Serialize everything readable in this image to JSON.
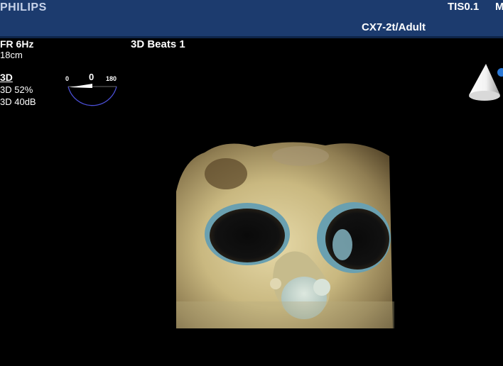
{
  "header": {
    "brand": "PHILIPS",
    "tis": "TIS0.1",
    "tis_extra": "M",
    "probe_preset": "CX7-2t/Adult"
  },
  "left_panel": {
    "frame_rate": "FR 6Hz",
    "depth": "18cm",
    "mode": "3D",
    "gain": "3D 52%",
    "compress": "3D 40dB"
  },
  "acquisition": {
    "beats": "3D Beats 1"
  },
  "rotation_dial": {
    "min": "0",
    "max": "180",
    "value": "0",
    "arc_color": "#4b4fd6"
  },
  "icons": {
    "rotation": "rotation-dial-icon",
    "orientation": "orientation-cone-icon"
  },
  "colors": {
    "header_bg": "#1c3b6e",
    "background": "#000000",
    "text": "#ffffff"
  }
}
